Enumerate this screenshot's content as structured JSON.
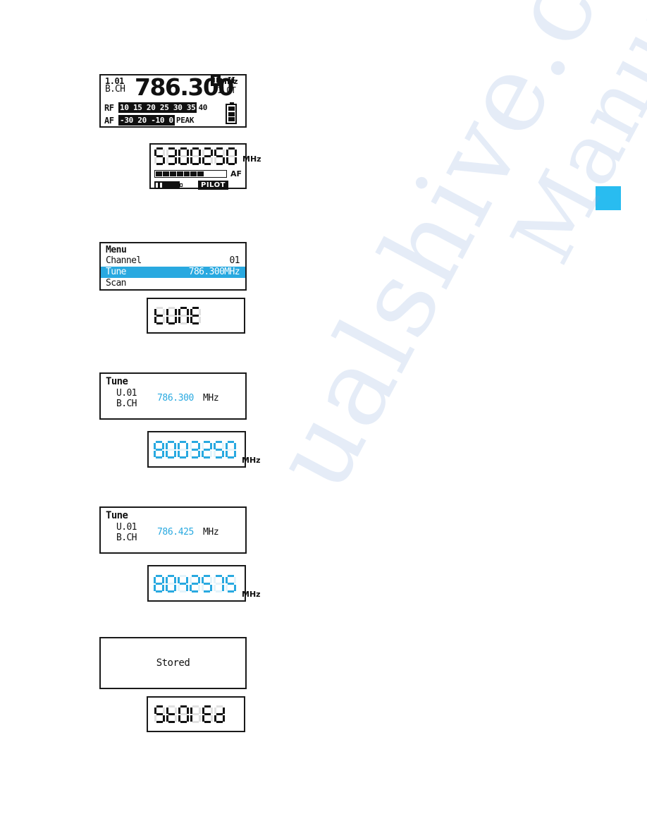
{
  "page": {
    "tab_marker_color": "#29bcf0",
    "accent_color": "#29a9e0",
    "watermark_line_1": "ualshive.com",
    "watermark_line_2": "Manuals"
  },
  "main_display": {
    "channel_number": "1.01",
    "channel_label": "B.CH",
    "frequency": "786.300",
    "frequency_unit": "MHz",
    "antenna_a": "I",
    "antenna_b": "II",
    "pilot_label": "PILOT",
    "rf_label": "RF",
    "rf_scale_active": "10 15 20 25 30 35",
    "rf_scale_tail": "40",
    "af_label": "AF",
    "af_scale_active": "-30  20 -10      0",
    "af_scale_tail": "PEAK",
    "battery_segments": 3
  },
  "segment_display_main": {
    "digits": "5300250",
    "unit": "MHz",
    "af_label": "AF",
    "af_bar_total": 10,
    "af_bar_filled": 7,
    "pilot_badge": "PILOT",
    "battery_segments": 2
  },
  "menu_display": {
    "title": "Menu",
    "rows": [
      {
        "label": "Channel",
        "value": "01",
        "selected": false
      },
      {
        "label": "Tune",
        "value": "786.300MHz",
        "selected": true
      },
      {
        "label": "Scan",
        "value": "",
        "selected": false
      }
    ]
  },
  "segment_display_tune": {
    "word": "TUNE"
  },
  "tune_display_1": {
    "title": "Tune",
    "user_channel": "U.01",
    "channel_label": "B.CH",
    "frequency": "786.300",
    "frequency_unit": "MHz"
  },
  "segment_display_freq_1": {
    "digits": "8003250",
    "unit": "MHz"
  },
  "tune_display_2": {
    "title": "Tune",
    "user_channel": "U.01",
    "channel_label": "B.CH",
    "frequency": "786.425",
    "frequency_unit": "MHz"
  },
  "segment_display_freq_2": {
    "digits": "8042575",
    "unit": "MHz"
  },
  "stored_display": {
    "message": "Stored"
  },
  "segment_display_stored": {
    "word": "STORED"
  }
}
